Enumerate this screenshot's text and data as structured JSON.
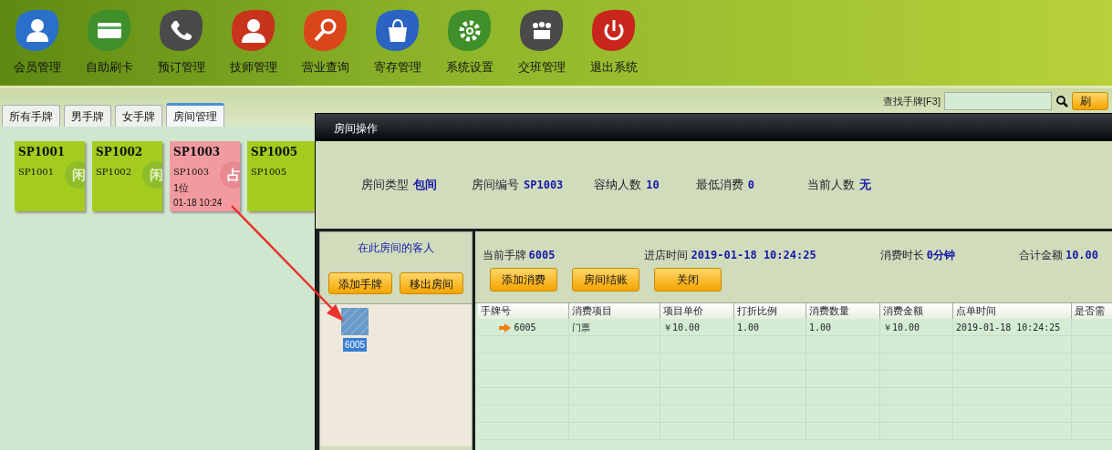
{
  "toolbar": [
    {
      "label": "会员管理",
      "kind": "person",
      "color": "#2a6fc9"
    },
    {
      "label": "自助刷卡",
      "kind": "card",
      "color": "#3f8f2a"
    },
    {
      "label": "预订管理",
      "kind": "phone",
      "color": "#4a4a4a"
    },
    {
      "label": "技师管理",
      "kind": "staff",
      "color": "#c8331c"
    },
    {
      "label": "营业查询",
      "kind": "search",
      "color": "#d9461a"
    },
    {
      "label": "寄存管理",
      "kind": "bag",
      "color": "#2a63c2"
    },
    {
      "label": "系统设置",
      "kind": "gear",
      "color": "#3f8f2a"
    },
    {
      "label": "交班管理",
      "kind": "meeting",
      "color": "#4a4a4a"
    },
    {
      "label": "退出系统",
      "kind": "power",
      "color": "#c8261c"
    }
  ],
  "tabs": [
    {
      "label": "所有手牌",
      "selected": false
    },
    {
      "label": "男手牌",
      "selected": false
    },
    {
      "label": "女手牌",
      "selected": false
    },
    {
      "label": "房间管理",
      "selected": true
    }
  ],
  "search": {
    "label": "查找手牌[F3]",
    "button": "刷"
  },
  "rooms": [
    {
      "title": "SP1001",
      "code": "SP1001",
      "kind": "free",
      "badge": "闲"
    },
    {
      "title": "SP1002",
      "code": "SP1002",
      "kind": "free",
      "badge": "闲"
    },
    {
      "title": "SP1003",
      "code": "SP1003",
      "kind": "occupied",
      "badge": "占",
      "guests": "1位",
      "time": "01-18 10:24"
    },
    {
      "title": "SP1005",
      "code": "SP1005",
      "kind": "free"
    }
  ],
  "dialog": {
    "title": "房间操作",
    "info": [
      {
        "label": "房间类型",
        "value": "包间"
      },
      {
        "label": "房间编号",
        "value": "SP1003"
      },
      {
        "label": "容纳人数",
        "value": "10"
      },
      {
        "label": "最低消费",
        "value": "0"
      },
      {
        "label": "当前人数",
        "value": "无"
      }
    ],
    "guests_panel": {
      "title": "在此房间的客人",
      "buttons": [
        "添加手牌",
        "移出房间"
      ],
      "guests": [
        {
          "label": "6005",
          "selected": true
        }
      ]
    },
    "summary": [
      {
        "label": "当前手牌",
        "value": "6005"
      },
      {
        "label": "进店时间",
        "value": "2019-01-18  10:24:25"
      },
      {
        "label": "消费时长",
        "value": "0分钟"
      },
      {
        "label": "合计金额",
        "value": "10.00"
      }
    ],
    "buttons": [
      "添加消费",
      "房间结账",
      "关闭"
    ],
    "table": {
      "columns": [
        "手牌号",
        "消费项目",
        "项目单价",
        "打折比例",
        "消费数量",
        "消费金额",
        "点单时间",
        "是否需"
      ],
      "rows": [
        [
          "6005",
          "门票",
          "￥10.00",
          "1.00",
          "1.00",
          "￥10.00",
          "2019-01-18 10:24:25",
          ""
        ]
      ]
    }
  }
}
